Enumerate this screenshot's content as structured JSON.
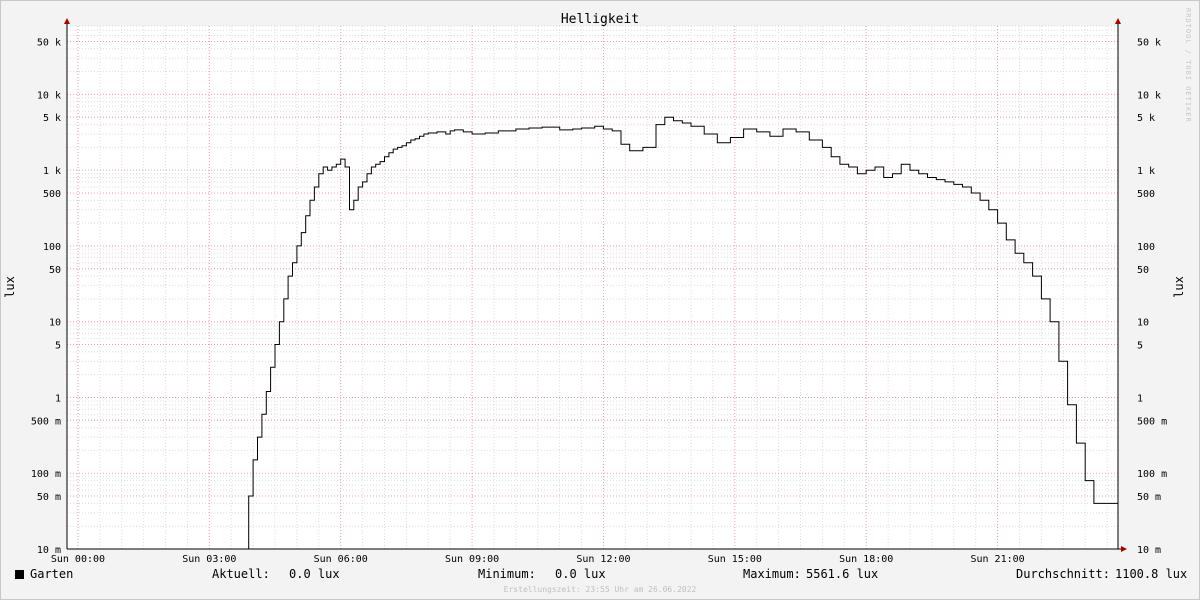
{
  "chart_data": {
    "type": "line",
    "title": "Helligkeit",
    "ylabel_left": "lux",
    "ylabel_right": "lux",
    "yscale": "log",
    "ylim": [
      0.01,
      80000
    ],
    "xlim_hours": [
      -0.25,
      23.75
    ],
    "xticks": [
      {
        "label": "Sun 00:00",
        "hour": 0
      },
      {
        "label": "Sun 03:00",
        "hour": 3
      },
      {
        "label": "Sun 06:00",
        "hour": 6
      },
      {
        "label": "Sun 09:00",
        "hour": 9
      },
      {
        "label": "Sun 12:00",
        "hour": 12
      },
      {
        "label": "Sun 15:00",
        "hour": 15
      },
      {
        "label": "Sun 18:00",
        "hour": 18
      },
      {
        "label": "Sun 21:00",
        "hour": 21
      }
    ],
    "yticks": [
      {
        "label": "50 k",
        "value": 50000
      },
      {
        "label": "10 k",
        "value": 10000
      },
      {
        "label": "5 k",
        "value": 5000
      },
      {
        "label": "1 k",
        "value": 1000
      },
      {
        "label": "500",
        "value": 500
      },
      {
        "label": "100",
        "value": 100
      },
      {
        "label": "50",
        "value": 50
      },
      {
        "label": "10",
        "value": 10
      },
      {
        "label": "5",
        "value": 5
      },
      {
        "label": "1",
        "value": 1
      },
      {
        "label": "500 m",
        "value": 0.5
      },
      {
        "label": "100 m",
        "value": 0.1
      },
      {
        "label": "50 m",
        "value": 0.05
      },
      {
        "label": "10 m",
        "value": 0.01
      }
    ],
    "series": [
      {
        "name": "Garten",
        "color": "#000000",
        "x": [
          -0.25,
          3.8,
          3.9,
          4.0,
          4.1,
          4.2,
          4.3,
          4.4,
          4.5,
          4.6,
          4.7,
          4.8,
          4.9,
          5.0,
          5.1,
          5.2,
          5.3,
          5.4,
          5.5,
          5.6,
          5.7,
          5.8,
          5.9,
          6.0,
          6.1,
          6.2,
          6.3,
          6.4,
          6.5,
          6.6,
          6.7,
          6.8,
          6.9,
          7.0,
          7.1,
          7.2,
          7.3,
          7.4,
          7.5,
          7.6,
          7.7,
          7.8,
          7.9,
          8.0,
          8.2,
          8.4,
          8.5,
          8.6,
          8.8,
          9.0,
          9.3,
          9.6,
          10.0,
          10.3,
          10.6,
          11.0,
          11.3,
          11.5,
          11.8,
          12.0,
          12.2,
          12.4,
          12.6,
          12.9,
          13.2,
          13.4,
          13.6,
          13.8,
          14.0,
          14.3,
          14.6,
          14.9,
          15.2,
          15.5,
          15.8,
          16.1,
          16.4,
          16.7,
          17.0,
          17.2,
          17.4,
          17.6,
          17.8,
          18.0,
          18.2,
          18.4,
          18.6,
          18.8,
          19.0,
          19.2,
          19.4,
          19.6,
          19.8,
          20.0,
          20.2,
          20.4,
          20.6,
          20.8,
          21.0,
          21.2,
          21.4,
          21.6,
          21.8,
          22.0,
          22.2,
          22.4,
          22.6,
          22.8,
          23.0,
          23.2,
          23.75
        ],
        "y": [
          0.01,
          0.01,
          0.05,
          0.15,
          0.3,
          0.6,
          1.2,
          2.5,
          5,
          10,
          20,
          40,
          60,
          100,
          150,
          250,
          400,
          600,
          900,
          1100,
          1000,
          1100,
          1200,
          1400,
          1100,
          300,
          400,
          600,
          700,
          900,
          1100,
          1200,
          1300,
          1500,
          1700,
          1900,
          2000,
          2100,
          2300,
          2500,
          2600,
          2800,
          3000,
          3100,
          3200,
          3000,
          3300,
          3400,
          3200,
          3000,
          3100,
          3300,
          3500,
          3600,
          3700,
          3400,
          3500,
          3600,
          3800,
          3500,
          3300,
          2200,
          1800,
          2000,
          4000,
          5000,
          4500,
          4200,
          3800,
          3000,
          2300,
          2700,
          3500,
          3200,
          2800,
          3500,
          3200,
          2500,
          2000,
          1500,
          1200,
          1100,
          900,
          1000,
          1100,
          800,
          900,
          1200,
          1000,
          900,
          800,
          750,
          700,
          650,
          600,
          500,
          400,
          300,
          200,
          120,
          80,
          60,
          40,
          20,
          10,
          3,
          0.8,
          0.25,
          0.08,
          0.04,
          0.01
        ],
        "current": "0.0 lux",
        "minimum": "0.0 lux",
        "maximum": "5561.6 lux",
        "average": "1100.8 lux"
      }
    ],
    "grid": true,
    "legend_position": "bottom"
  },
  "legend": {
    "series_name": "Garten",
    "current_label": "Aktuell:",
    "current_value": "0.0 lux",
    "minimum_label": "Minimum:",
    "minimum_value": "0.0 lux",
    "maximum_label": "Maximum:",
    "maximum_value": "5561.6 lux",
    "average_label": "Durchschnitt:",
    "average_value": "1100.8 lux"
  },
  "footer": "Erstellungszeit: 23:55 Uhr am 26.06.2022",
  "watermark": "RRDTOOL / TOBI OETIKER"
}
